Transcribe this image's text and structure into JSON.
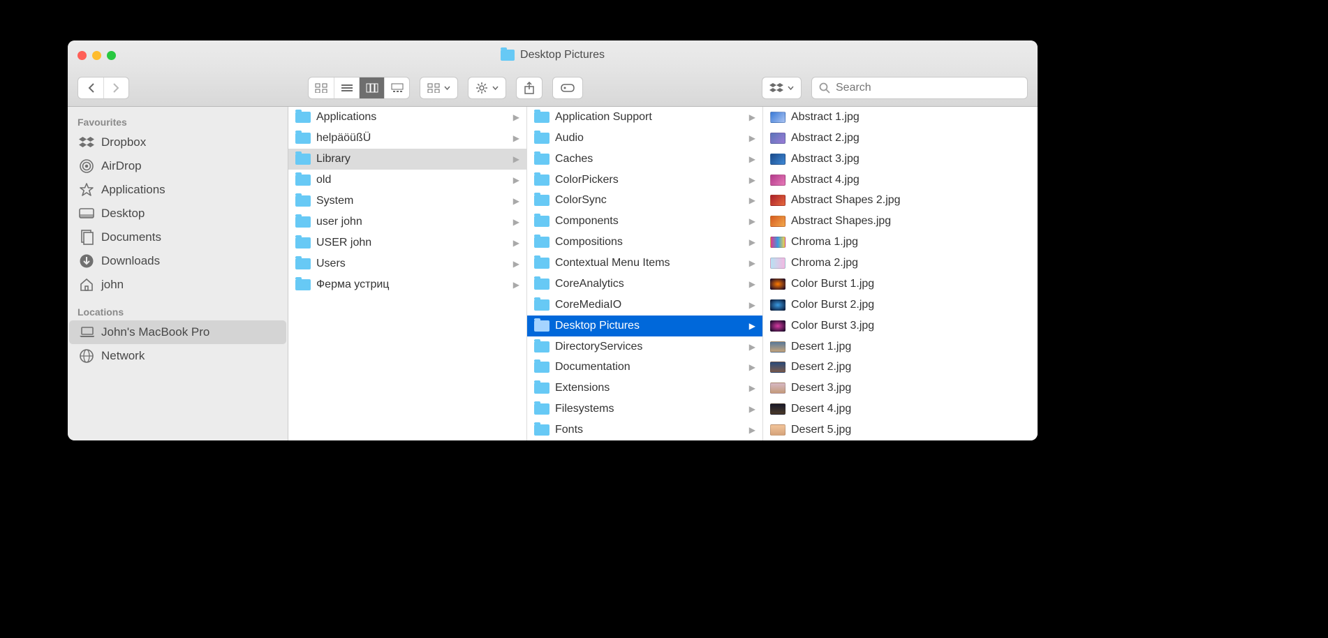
{
  "window": {
    "title": "Desktop Pictures"
  },
  "search": {
    "placeholder": "Search"
  },
  "sidebar": {
    "sections": [
      {
        "label": "Favourites",
        "items": [
          {
            "icon": "dropbox",
            "label": "Dropbox"
          },
          {
            "icon": "airdrop",
            "label": "AirDrop"
          },
          {
            "icon": "applications",
            "label": "Applications"
          },
          {
            "icon": "desktop",
            "label": "Desktop"
          },
          {
            "icon": "documents",
            "label": "Documents"
          },
          {
            "icon": "downloads",
            "label": "Downloads"
          },
          {
            "icon": "home",
            "label": "john"
          }
        ]
      },
      {
        "label": "Locations",
        "items": [
          {
            "icon": "laptop",
            "label": "John's MacBook Pro",
            "selected": true
          },
          {
            "icon": "network",
            "label": "Network"
          }
        ]
      }
    ]
  },
  "columns": [
    {
      "kind": "folders",
      "items": [
        {
          "label": "Applications"
        },
        {
          "label": "helpäöüßÜ"
        },
        {
          "label": "Library",
          "state": "sel-gray"
        },
        {
          "label": "old"
        },
        {
          "label": "System"
        },
        {
          "label": "user john"
        },
        {
          "label": "USER john"
        },
        {
          "label": "Users"
        },
        {
          "label": "Ферма устриц"
        }
      ]
    },
    {
      "kind": "folders",
      "items": [
        {
          "label": "Application Support"
        },
        {
          "label": "Audio"
        },
        {
          "label": "Caches"
        },
        {
          "label": "ColorPickers"
        },
        {
          "label": "ColorSync"
        },
        {
          "label": "Components"
        },
        {
          "label": "Compositions"
        },
        {
          "label": "Contextual Menu Items"
        },
        {
          "label": "CoreAnalytics"
        },
        {
          "label": "CoreMediaIO"
        },
        {
          "label": "Desktop Pictures",
          "state": "sel-blue"
        },
        {
          "label": "DirectoryServices"
        },
        {
          "label": "Documentation"
        },
        {
          "label": "Extensions"
        },
        {
          "label": "Filesystems"
        },
        {
          "label": "Fonts"
        }
      ]
    },
    {
      "kind": "files",
      "items": [
        {
          "label": "Abstract 1.jpg",
          "swatch": "linear-gradient(135deg,#3a7ad6,#aac3f2)"
        },
        {
          "label": "Abstract 2.jpg",
          "swatch": "linear-gradient(135deg,#5a74b8,#9a7bd6)"
        },
        {
          "label": "Abstract 3.jpg",
          "swatch": "linear-gradient(135deg,#1a4a8a,#3f89d6)"
        },
        {
          "label": "Abstract 4.jpg",
          "swatch": "linear-gradient(135deg,#b23a8a,#e77ab8)"
        },
        {
          "label": "Abstract Shapes 2.jpg",
          "swatch": "linear-gradient(135deg,#aa1f2a,#e66a3d)"
        },
        {
          "label": "Abstract Shapes.jpg",
          "swatch": "linear-gradient(135deg,#d65a1f,#f2a94c)"
        },
        {
          "label": "Chroma 1.jpg",
          "swatch": "linear-gradient(90deg,#e13a8a,#3a9ae1,#f2d24c)"
        },
        {
          "label": "Chroma 2.jpg",
          "swatch": "linear-gradient(90deg,#b8e1f2,#f2b8e1)"
        },
        {
          "label": "Color Burst 1.jpg",
          "swatch": "radial-gradient(#ff7a00,#1a0a2a)"
        },
        {
          "label": "Color Burst 2.jpg",
          "swatch": "radial-gradient(#3a9ae1,#0a1a3a)"
        },
        {
          "label": "Color Burst 3.jpg",
          "swatch": "radial-gradient(#d63aa1,#1a0a2a)"
        },
        {
          "label": "Desert 1.jpg",
          "swatch": "linear-gradient(#5a7a9a,#c4a37a)"
        },
        {
          "label": "Desert 2.jpg",
          "swatch": "linear-gradient(#2a4a7a,#7a5a4a)"
        },
        {
          "label": "Desert 3.jpg",
          "swatch": "linear-gradient(#d6b8c4,#c49a7a)"
        },
        {
          "label": "Desert 4.jpg",
          "swatch": "linear-gradient(#1a1a2a,#4a3a2a)"
        },
        {
          "label": "Desert 5.jpg",
          "swatch": "linear-gradient(#f2c49a,#d6a37a)"
        }
      ]
    }
  ]
}
